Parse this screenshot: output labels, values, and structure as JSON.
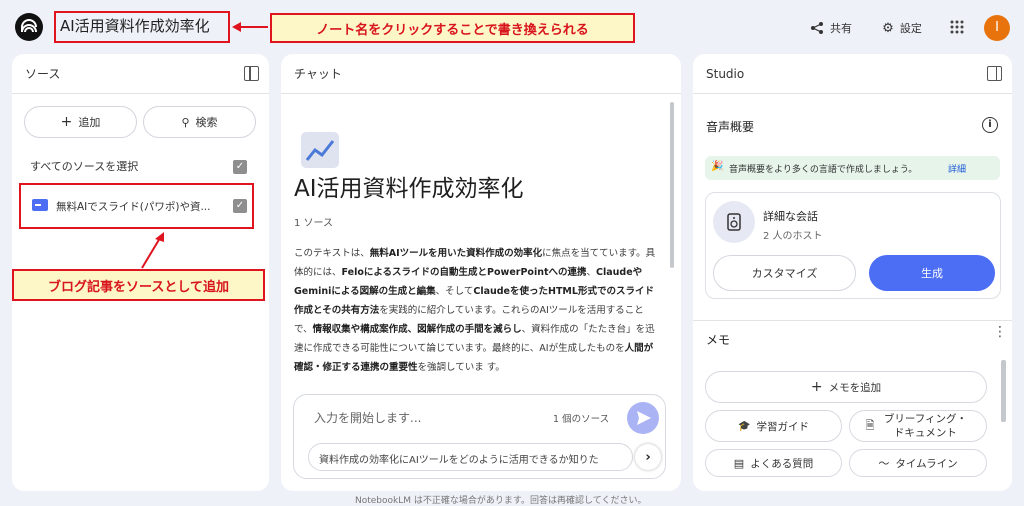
{
  "header": {
    "notebook_title": "AI活用資料作成効率化",
    "share_label": "共有",
    "settings_label": "設定",
    "avatar_letter": "I"
  },
  "annotations": {
    "title_callout": "ノート名をクリックすることで書き換えられる",
    "source_callout": "ブログ記事をソースとして追加"
  },
  "sources": {
    "title": "ソース",
    "add_label": "追加",
    "search_label": "検索",
    "select_all_label": "すべてのソースを選択",
    "items": [
      {
        "label": "無料AIでスライド(パワポ)や資..."
      }
    ]
  },
  "chat": {
    "title": "チャット",
    "notebook_heading": "AI活用資料作成効率化",
    "source_count": "1 ソース",
    "summary_html": "このテキストは、<b>無料AIツールを用いた資料作成の効率化</b>に焦点を当てています。具体的には、<b>Feloによるスライドの自動生成とPowerPointへの連携</b>、<b>ClaudeやGeminiによる図解の生成と編集</b>、そして<b>Claudeを使ったHTML形式でのスライド作成とその共有方法</b>を実践的に紹介しています。これらのAIツールを活用することで、<b>情報収集や構成案作成、図解作成の手間を減らし</b>、資料作成の「たたき台」を迅速に作成できる可能性について論じています。最終的に、AIが生成したものを<b>人間が確認・修正する連携の重要性</b>を強調していま す。",
    "input_placeholder": "入力を開始します...",
    "input_source_count": "1 個のソース",
    "suggestion": "資料作成の効率化にAIツールをどのように活用できるか知りた"
  },
  "studio": {
    "title": "Studio",
    "audio_title": "音声概要",
    "banner_text": "音声概要をより多くの言語で作成しましょう。",
    "banner_link": "詳細",
    "conversation_title": "詳細な会話",
    "conversation_hosts": "2 人のホスト",
    "customize_label": "カスタマイズ",
    "generate_label": "生成",
    "memo_title": "メモ",
    "add_memo_label": "メモを追加",
    "study_guide_label": "学習ガイド",
    "briefing_label": "ブリーフィング・ドキュメント",
    "faq_label": "よくある質問",
    "timeline_label": "タイムライン"
  },
  "footer": {
    "disclaimer": "NotebookLM は不正確な場合があります。回答は再確認してください。"
  },
  "colors": {
    "accent": "#4c6ef5",
    "avatar": "#e8730c",
    "annotation_red": "#e0141e",
    "callout_bg": "#fdf6c7"
  }
}
